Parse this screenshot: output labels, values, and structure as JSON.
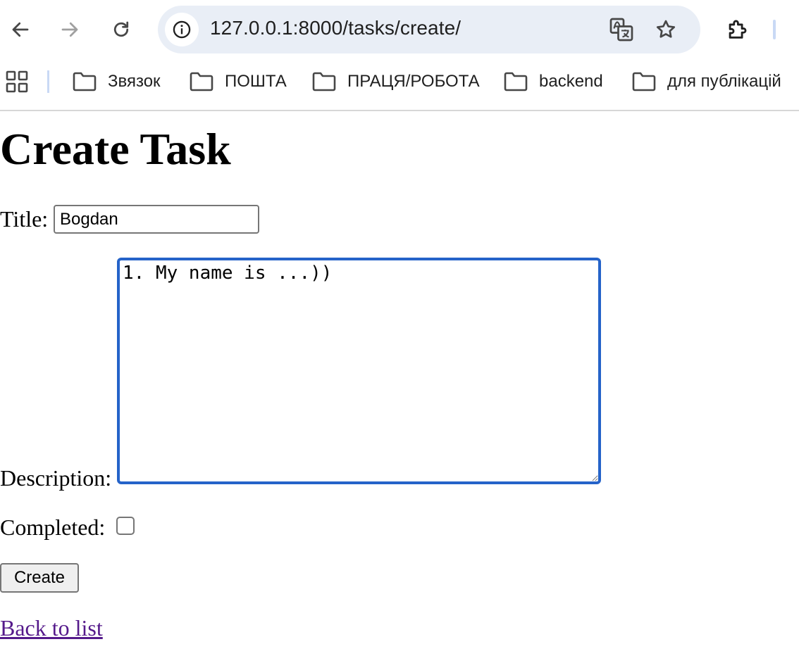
{
  "browser": {
    "url": "127.0.0.1:8000/tasks/create/",
    "bookmarks": [
      {
        "label": "Звязок",
        "icon": "folder-icon"
      },
      {
        "label": "ПОШТА",
        "icon": "folder-icon"
      },
      {
        "label": "ПРАЦЯ/РОБОТА",
        "icon": "folder-icon"
      },
      {
        "label": "backend",
        "icon": "folder-icon"
      },
      {
        "label": "для публікацій",
        "icon": "folder-icon"
      }
    ],
    "icons": {
      "back": "arrow-left-icon",
      "forward": "arrow-right-icon",
      "reload": "reload-icon",
      "site_info": "info-icon",
      "translate": "translate-icon",
      "bookmark": "star-icon",
      "extensions": "puzzle-icon",
      "apps": "apps-grid-icon"
    },
    "colors": {
      "omnibox_bg": "#e9eef6",
      "focus_ring": "#2563c9",
      "visited_link": "#551a8b"
    }
  },
  "page": {
    "heading": "Create Task",
    "form": {
      "title_label": "Title:",
      "title_value": "Bogdan",
      "description_label": "Description:",
      "description_value": "1. My name is ...))",
      "completed_label": "Completed:",
      "completed_checked": false,
      "submit_label": "Create"
    },
    "back_link": "Back to list"
  }
}
